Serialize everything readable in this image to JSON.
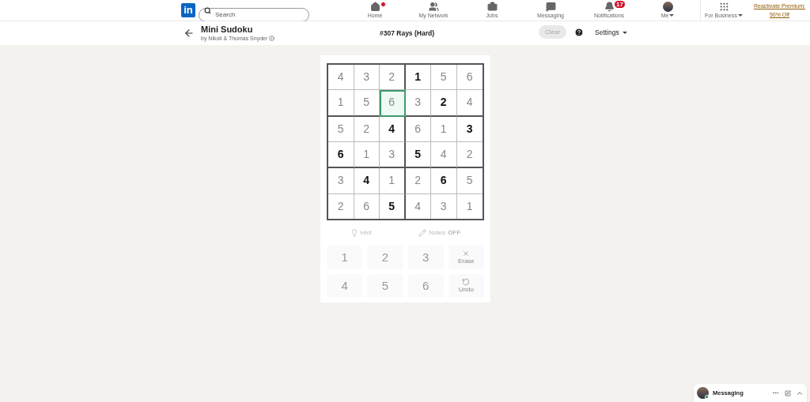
{
  "nav": {
    "logo": "in",
    "search": {
      "placeholder": "Search"
    },
    "items": [
      {
        "kind": "home",
        "label": "Home",
        "dot": true
      },
      {
        "kind": "network",
        "label": "My Network",
        "dot": false
      },
      {
        "kind": "jobs",
        "label": "Jobs",
        "dot": false
      },
      {
        "kind": "messaging",
        "label": "Messaging",
        "dot": false
      },
      {
        "kind": "notifications",
        "label": "Notifications",
        "dot": false,
        "badge": "17"
      },
      {
        "kind": "me",
        "label": "Me",
        "dot": false
      }
    ],
    "for_business": "For Business",
    "premium": [
      "Reactivate Premium:",
      "50% Off"
    ]
  },
  "header": {
    "title": "Mini Sudoku",
    "byline": "by Nikoli & Thomas Snyder",
    "puzzle": "#307 Rays (Hard)",
    "clear": {
      "label": "Clear",
      "disabled": true
    },
    "settings": "Settings"
  },
  "grid": [
    [
      {
        "value": "4",
        "given": false,
        "selected": false
      },
      {
        "value": "3",
        "given": false,
        "selected": false
      },
      {
        "value": "2",
        "given": false,
        "selected": false
      },
      {
        "value": "1",
        "given": true,
        "selected": false
      },
      {
        "value": "5",
        "given": false,
        "selected": false
      },
      {
        "value": "6",
        "given": false,
        "selected": false
      }
    ],
    [
      {
        "value": "1",
        "given": false,
        "selected": false
      },
      {
        "value": "5",
        "given": false,
        "selected": false
      },
      {
        "value": "6",
        "given": false,
        "selected": true
      },
      {
        "value": "3",
        "given": false,
        "selected": false
      },
      {
        "value": "2",
        "given": true,
        "selected": false
      },
      {
        "value": "4",
        "given": false,
        "selected": false
      }
    ],
    [
      {
        "value": "5",
        "given": false,
        "selected": false
      },
      {
        "value": "2",
        "given": false,
        "selected": false
      },
      {
        "value": "4",
        "given": true,
        "selected": false
      },
      {
        "value": "6",
        "given": false,
        "selected": false
      },
      {
        "value": "1",
        "given": false,
        "selected": false
      },
      {
        "value": "3",
        "given": true,
        "selected": false
      }
    ],
    [
      {
        "value": "6",
        "given": true,
        "selected": false
      },
      {
        "value": "1",
        "given": false,
        "selected": false
      },
      {
        "value": "3",
        "given": false,
        "selected": false
      },
      {
        "value": "5",
        "given": true,
        "selected": false
      },
      {
        "value": "4",
        "given": false,
        "selected": false
      },
      {
        "value": "2",
        "given": false,
        "selected": false
      }
    ],
    [
      {
        "value": "3",
        "given": false,
        "selected": false
      },
      {
        "value": "4",
        "given": true,
        "selected": false
      },
      {
        "value": "1",
        "given": false,
        "selected": false
      },
      {
        "value": "2",
        "given": false,
        "selected": false
      },
      {
        "value": "6",
        "given": true,
        "selected": false
      },
      {
        "value": "5",
        "given": false,
        "selected": false
      }
    ],
    [
      {
        "value": "2",
        "given": false,
        "selected": false
      },
      {
        "value": "6",
        "given": false,
        "selected": false
      },
      {
        "value": "5",
        "given": true,
        "selected": false
      },
      {
        "value": "4",
        "given": false,
        "selected": false
      },
      {
        "value": "3",
        "given": false,
        "selected": false
      },
      {
        "value": "1",
        "given": false,
        "selected": false
      }
    ]
  ],
  "tools": {
    "hint": "Hint",
    "notes": "Notes",
    "notes_state": "OFF"
  },
  "keypad": [
    {
      "kind": "digit",
      "label": "1"
    },
    {
      "kind": "digit",
      "label": "2"
    },
    {
      "kind": "digit",
      "label": "3"
    },
    {
      "kind": "erase",
      "label": "Erase"
    },
    {
      "kind": "digit",
      "label": "4"
    },
    {
      "kind": "digit",
      "label": "5"
    },
    {
      "kind": "digit",
      "label": "6"
    },
    {
      "kind": "undo",
      "label": "Undo"
    }
  ],
  "messaging": {
    "label": "Messaging"
  }
}
